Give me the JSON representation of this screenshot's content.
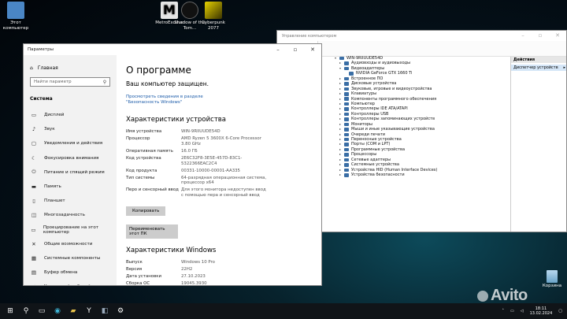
{
  "desktop": {
    "icons": [
      {
        "label": "Этот компьютер",
        "color": "#4a86c5"
      },
      {
        "label": "MetroExodus",
        "color": "#dddddd"
      },
      {
        "label": "Shadow of the Tom...",
        "color": "#222222"
      },
      {
        "label": "Cyberpunk 2077",
        "color": "#c9b300"
      }
    ],
    "recycle_bin": "Корзина",
    "watermark": "Avito"
  },
  "settings": {
    "window_title": "Параметры",
    "home_label": "Главная",
    "search_placeholder": "Найти параметр",
    "section": "Система",
    "items": [
      {
        "icon": "display-icon",
        "glyph": "▭",
        "label": "Дисплей"
      },
      {
        "icon": "sound-icon",
        "glyph": "♪",
        "label": "Звук"
      },
      {
        "icon": "notifications-icon",
        "glyph": "▢",
        "label": "Уведомления и действия"
      },
      {
        "icon": "focus-assist-icon",
        "glyph": "☾",
        "label": "Фокусировка внимания"
      },
      {
        "icon": "power-icon",
        "glyph": "⏻",
        "label": "Питание и спящий режим"
      },
      {
        "icon": "storage-icon",
        "glyph": "▬",
        "label": "Память"
      },
      {
        "icon": "tablet-icon",
        "glyph": "▯",
        "label": "Планшет"
      },
      {
        "icon": "multitasking-icon",
        "glyph": "◫",
        "label": "Многозадачность"
      },
      {
        "icon": "projecting-icon",
        "glyph": "▭",
        "label": "Проецирование на этот компьютер"
      },
      {
        "icon": "shared-experiences-icon",
        "glyph": "✕",
        "label": "Общие возможности"
      },
      {
        "icon": "system-components-icon",
        "glyph": "▦",
        "label": "Системные компоненты"
      },
      {
        "icon": "clipboard-icon",
        "glyph": "▤",
        "label": "Буфер обмена"
      },
      {
        "icon": "remote-desktop-icon",
        "glyph": "⇄",
        "label": "Удаленный рабочий стол"
      }
    ],
    "page_title": "О программе",
    "protected_text": "Ваш компьютер защищен.",
    "security_link": "Просмотреть сведения в разделе \"Безопасность Windows\"",
    "device_heading": "Характеристики устройства",
    "device_specs": [
      {
        "k": "Имя устройства",
        "v": "WIN-9RIIUUDE54D"
      },
      {
        "k": "Процессор",
        "v": "AMD Ryzen 5 3600X 6-Core Processor 3.80 GHz"
      },
      {
        "k": "Оперативная память",
        "v": "16.0 ГБ"
      },
      {
        "k": "Код устройства",
        "v": "2E6C32F8-3E5E-457D-83C1-5322366EAC2C4"
      },
      {
        "k": "Код продукта",
        "v": "00331-10000-00001-AA335"
      },
      {
        "k": "Тип системы",
        "v": "64-разрядная операционная система, процессор x64"
      },
      {
        "k": "Перо и сенсорный ввод",
        "v": "Для этого монитора недоступен ввод с помощью пера и сенсорный ввод"
      }
    ],
    "copy_button": "Копировать",
    "rename_button": "Переименовать этот ПК",
    "windows_heading": "Характеристики Windows",
    "windows_specs": [
      {
        "k": "Выпуск",
        "v": "Windows 10 Pro"
      },
      {
        "k": "Версия",
        "v": "22H2"
      },
      {
        "k": "Дата установки",
        "v": "27.10.2023"
      },
      {
        "k": "Сборка ОС",
        "v": "19045.3930"
      },
      {
        "k": "Взаимодействие",
        "v": "Windows Feature Experience Pack 1000.19053.1000.0"
      }
    ]
  },
  "device_manager": {
    "window_title": "Управление компьютером",
    "root": "WIN-9RIIUUDE54D",
    "nodes": [
      {
        "label": "Аудиовходы и аудиовыходы",
        "level": 1,
        "expanded": false
      },
      {
        "label": "Видеоадаптеры",
        "level": 1,
        "expanded": true
      },
      {
        "label": "NVIDIA GeForce GTX 1660 Ti",
        "level": 2,
        "expanded": null
      },
      {
        "label": "Встроенное ПО",
        "level": 1,
        "expanded": false
      },
      {
        "label": "Дисковые устройства",
        "level": 1,
        "expanded": false
      },
      {
        "label": "Звуковые, игровые и видеоустройства",
        "level": 1,
        "expanded": false
      },
      {
        "label": "Клавиатуры",
        "level": 1,
        "expanded": false
      },
      {
        "label": "Компоненты программного обеспечения",
        "level": 1,
        "expanded": false
      },
      {
        "label": "Компьютер",
        "level": 1,
        "expanded": false
      },
      {
        "label": "Контроллеры IDE ATA/ATAPI",
        "level": 1,
        "expanded": false
      },
      {
        "label": "Контроллеры USB",
        "level": 1,
        "expanded": false
      },
      {
        "label": "Контроллеры запоминающих устройств",
        "level": 1,
        "expanded": false
      },
      {
        "label": "Мониторы",
        "level": 1,
        "expanded": false
      },
      {
        "label": "Мыши и иные указывающие устройства",
        "level": 1,
        "expanded": false
      },
      {
        "label": "Очереди печати",
        "level": 1,
        "expanded": false
      },
      {
        "label": "Переносные устройства",
        "level": 1,
        "expanded": false
      },
      {
        "label": "Порты (COM и LPT)",
        "level": 1,
        "expanded": false
      },
      {
        "label": "Программные устройства",
        "level": 1,
        "expanded": false
      },
      {
        "label": "Процессоры",
        "level": 1,
        "expanded": false
      },
      {
        "label": "Сетевые адаптеры",
        "level": 1,
        "expanded": false
      },
      {
        "label": "Системные устройства",
        "level": 1,
        "expanded": false
      },
      {
        "label": "Устройства HID (Human Interface Devices)",
        "level": 1,
        "expanded": false
      },
      {
        "label": "Устройства безопасности",
        "level": 1,
        "expanded": false
      }
    ],
    "actions_header": "Действия",
    "actions_item": "Диспетчер устройств"
  },
  "taskbar": {
    "time": "18:11",
    "date": "13.02.2024"
  }
}
